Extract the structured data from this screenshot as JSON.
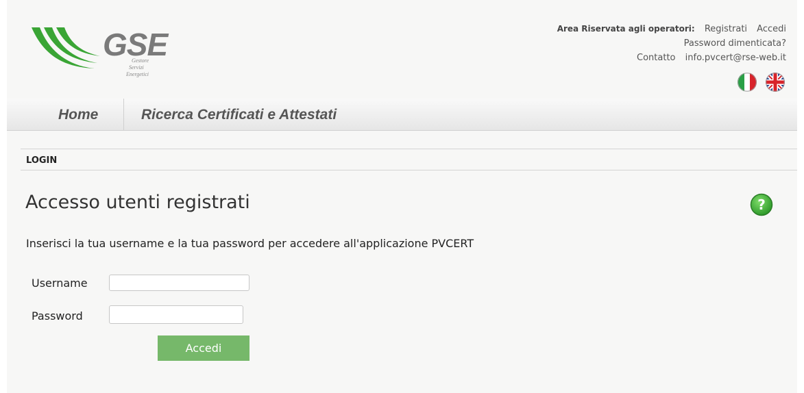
{
  "header": {
    "logo": {
      "wordmark": "GSE",
      "sub_lines": [
        "Gestore",
        "Servizi",
        "Energetici"
      ],
      "color": "#3aa535"
    },
    "area_label": "Area Riservata agli operatori:",
    "register_link": "Registrati",
    "login_link": "Accedi",
    "forgot_password_link": "Password dimenticata?",
    "contact_label": "Contatto",
    "contact_email": "info.pvcert@rse-web.it",
    "languages": [
      "italian-flag-icon",
      "uk-flag-icon"
    ]
  },
  "nav": {
    "items": [
      {
        "label": "Home"
      },
      {
        "label": "Ricerca Certificati e Attestati"
      }
    ]
  },
  "main": {
    "breadcrumb": "LOGIN",
    "title": "Accesso utenti registrati",
    "intro": "Inserisci la tua username e la tua password per accedere all'applicazione PVCERT",
    "help_icon": "question-icon",
    "form": {
      "username_label": "Username",
      "username_value": "",
      "password_label": "Password",
      "password_value": "",
      "submit_label": "Accedi"
    }
  },
  "colors": {
    "accent_green": "#3aa535",
    "button_green": "#76b86a"
  }
}
